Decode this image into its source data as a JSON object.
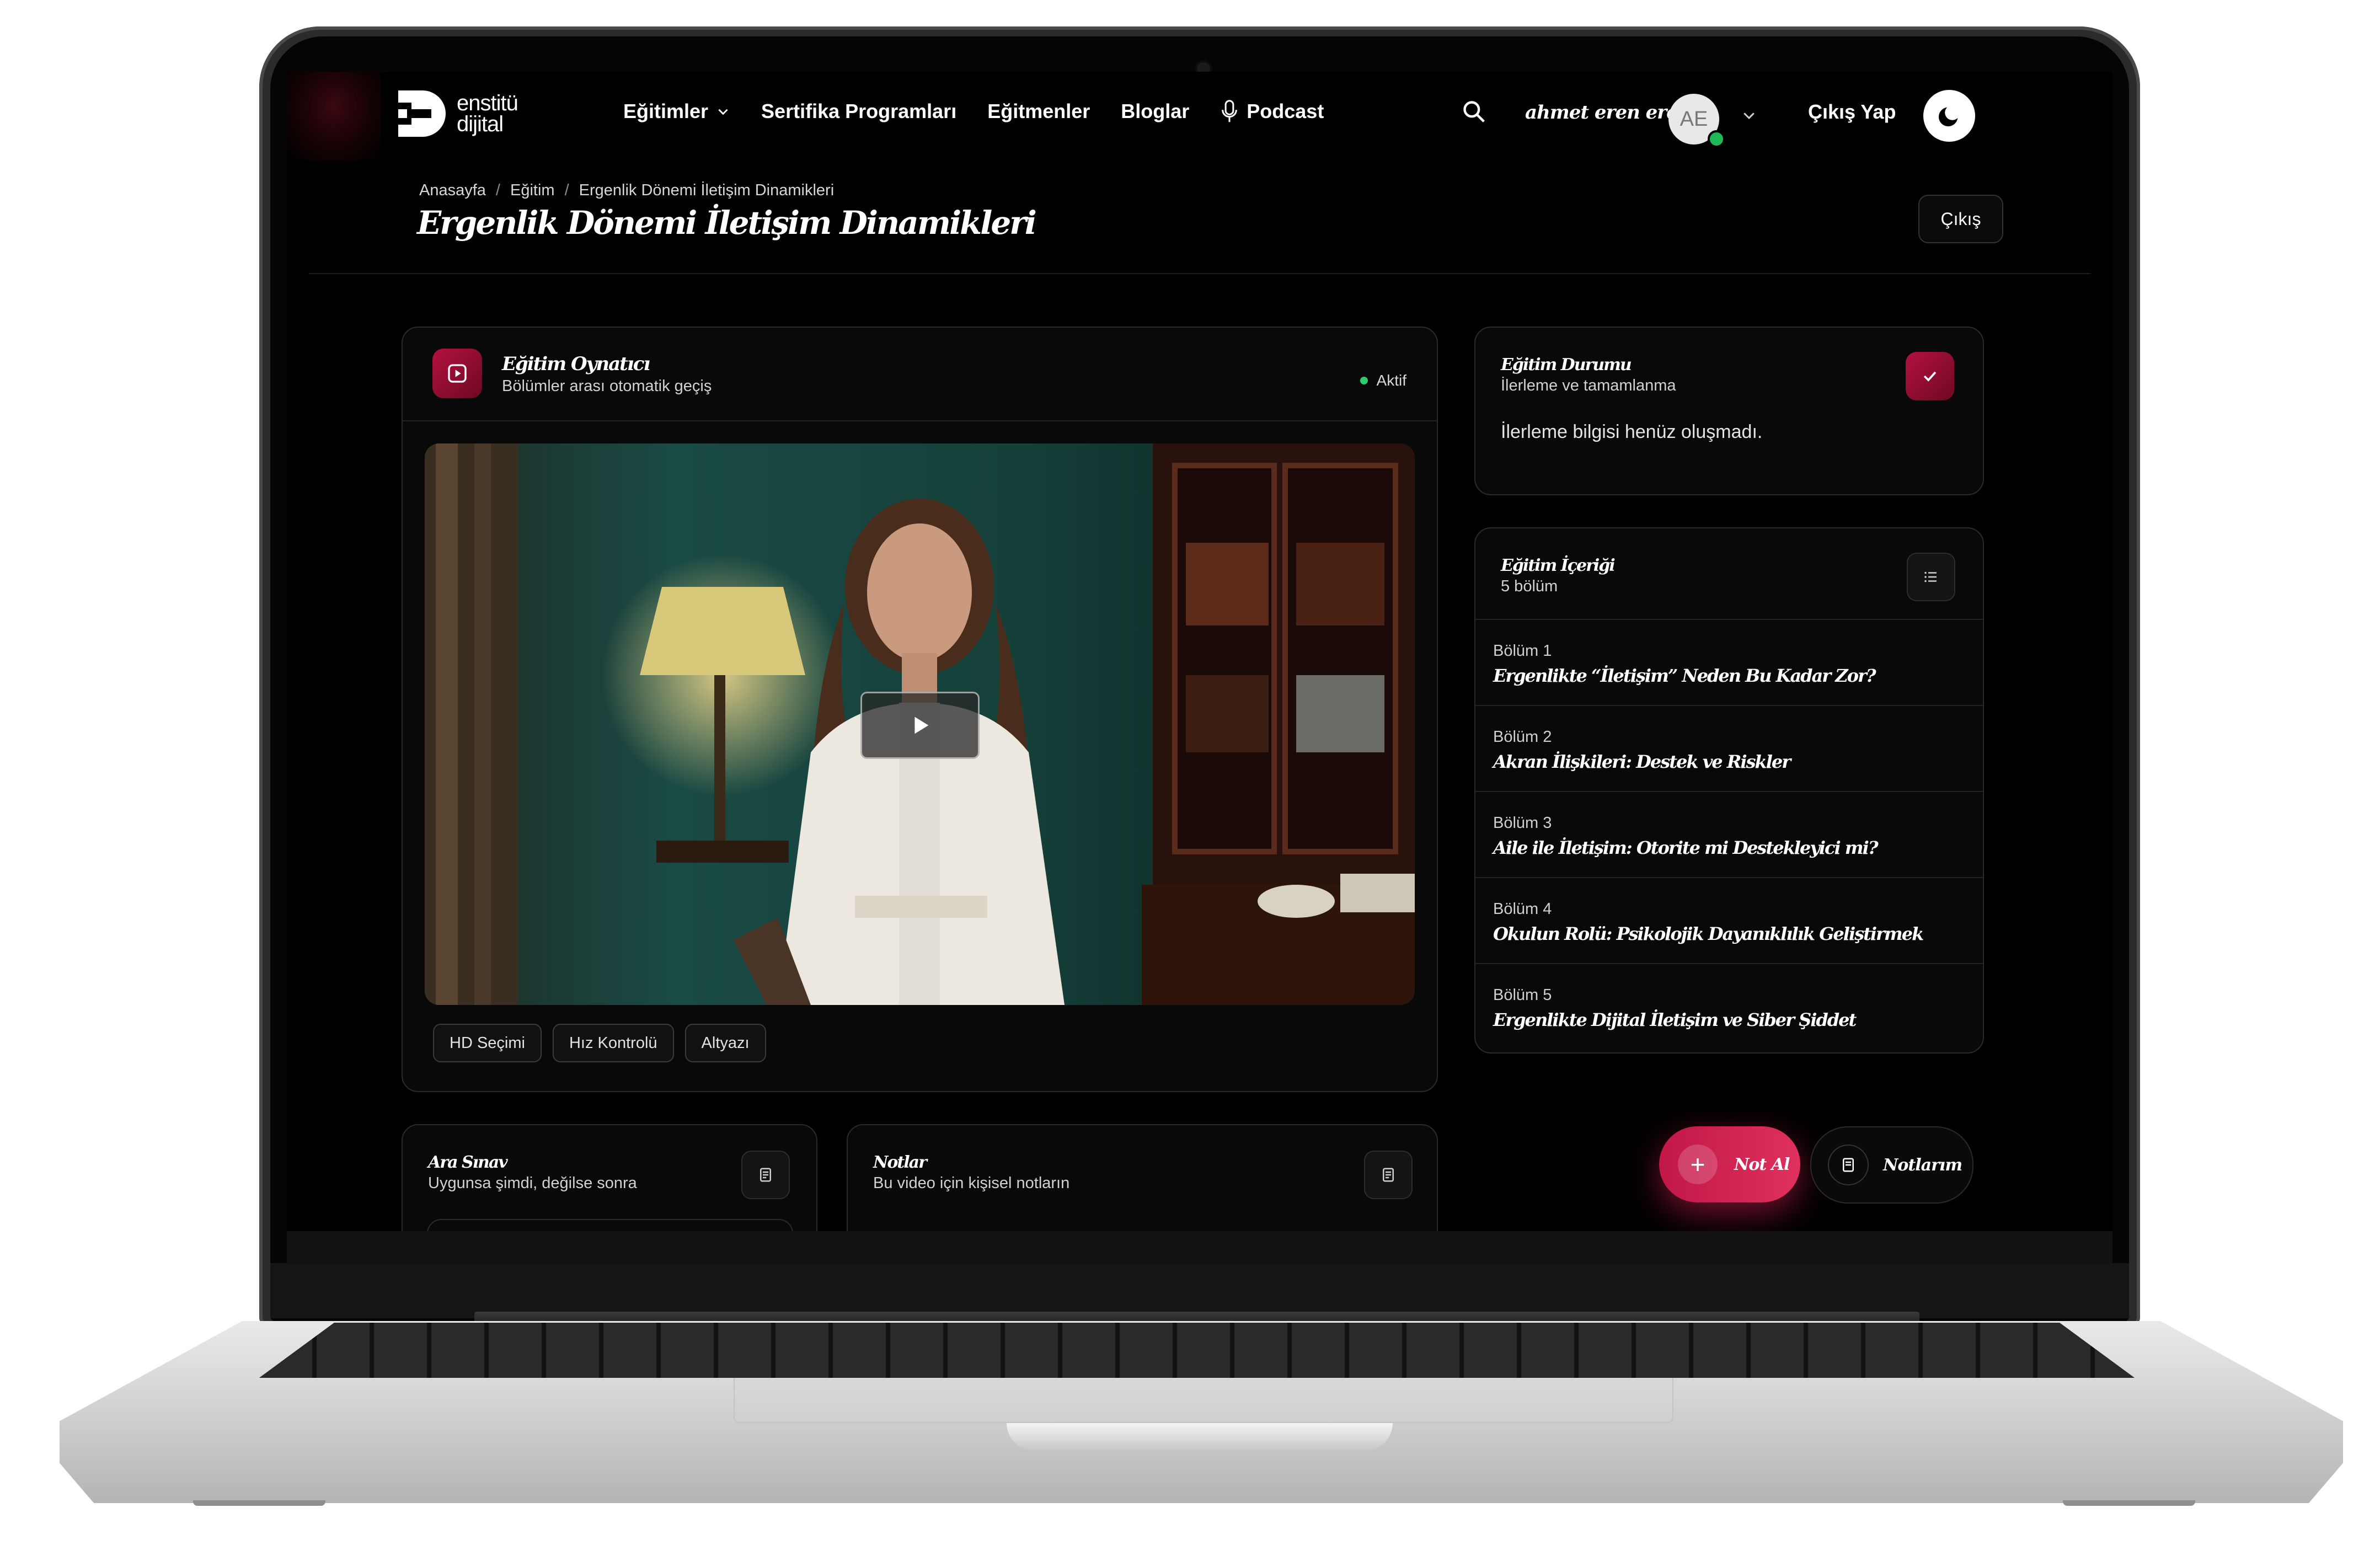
{
  "brand": {
    "line1": "enstitü",
    "line2": "dijital"
  },
  "nav": {
    "items": [
      {
        "label": "Eğitimler",
        "has_dropdown": true
      },
      {
        "label": "Sertifika Programları"
      },
      {
        "label": "Eğitmenler"
      },
      {
        "label": "Bloglar"
      },
      {
        "label": "Podcast",
        "icon": "microphone-icon"
      }
    ]
  },
  "header": {
    "user_name": "ahmet eren eren",
    "avatar_initials": "AE",
    "logout_label": "Çıkış Yap"
  },
  "breadcrumb": [
    "Anasayfa",
    "Eğitim",
    "Ergenlik Dönemi İletişim Dinamikleri"
  ],
  "page": {
    "title": "Ergenlik Dönemi İletişim Dinamikleri",
    "exit_label": "Çıkış"
  },
  "player": {
    "title": "Eğitim Oynatıcı",
    "subtitle": "Bölümler arası otomatik geçiş",
    "status": "Aktif",
    "status_color": "#2ecc71",
    "chips": [
      "HD Seçimi",
      "Hız Kontrolü",
      "Altyazı"
    ]
  },
  "progress": {
    "title": "Eğitim Durumu",
    "subtitle": "İlerleme ve tamamlanma",
    "message": "İlerleme bilgisi henüz oluşmadı."
  },
  "content": {
    "title": "Eğitim İçeriği",
    "count": "5 bölüm",
    "lessons": [
      {
        "num": "Bölüm 1",
        "name": "Ergenlikte “İletişim” Neden Bu Kadar Zor?"
      },
      {
        "num": "Bölüm 2",
        "name": "Akran İlişkileri: Destek ve Riskler"
      },
      {
        "num": "Bölüm 3",
        "name": "Aile ile İletişim: Otorite mi Destekleyici mi?"
      },
      {
        "num": "Bölüm 4",
        "name": "Okulun Rolü: Psikolojik Dayanıklılık Geliştirmek"
      },
      {
        "num": "Bölüm 5",
        "name": "Ergenlikte Dijital İletişim ve Siber Şiddet"
      }
    ]
  },
  "quiz": {
    "title": "Ara Sınav",
    "subtitle": "Uygunsa şimdi, değilse sonra"
  },
  "notes": {
    "title": "Notlar",
    "subtitle": "Bu video için kişisel notların"
  },
  "actions": {
    "take_note": "Not Al",
    "my_notes": "Notlarım"
  },
  "colors": {
    "accent": "#c11847",
    "background": "#000000",
    "card": "#090909"
  }
}
